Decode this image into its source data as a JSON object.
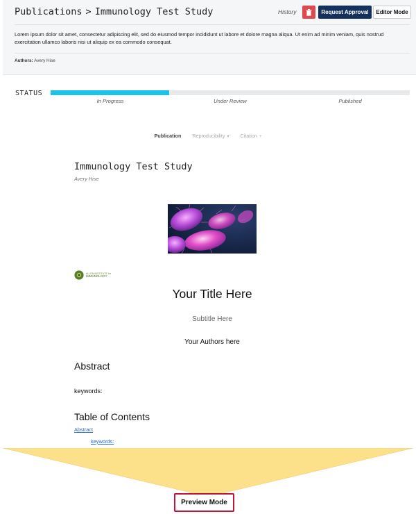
{
  "header": {
    "breadcrumb_root": "Publications",
    "breadcrumb_separator": ">",
    "breadcrumb_current": "Immunology Test Study",
    "history_label": "History",
    "delete_icon": "trash-icon",
    "request_approval_label": "Request Approval",
    "editor_mode_label": "Editor Mode",
    "description": "Lorem ipsum dolor sit amet, consectetur adipiscing elit, sed do eiusmod tempor incididunt ut labore et dolore magna aliqua. Ut enim ad minim veniam, quis nostrud exercitation ullamco laboris nisi ut aliquip ex ea commodo consequat.",
    "authors_label": "Authors:",
    "authors_value": "Avery Hise"
  },
  "status": {
    "label": "STATUS",
    "stages": [
      "In Progress",
      "Under Review",
      "Published"
    ],
    "current_stage_index": 0,
    "progress_fraction": 0.33,
    "fill_color": "#1ec2e6"
  },
  "tabs": [
    {
      "label": "Publication",
      "active": true,
      "caret": ""
    },
    {
      "label": "Reproducibility",
      "active": false,
      "caret": "▾"
    },
    {
      "label": "Citation",
      "active": false,
      "caret": "+"
    }
  ],
  "document": {
    "title": "Immunology Test Study",
    "author": "Avery Hise",
    "hero_image": "microbe-image",
    "logo_line1": "ALLEN INSTITUTE for",
    "logo_line2": "IMMUNOLOGY",
    "your_title": "Your Title Here",
    "subtitle": "Subtitle Here",
    "your_authors": "Your Authors here",
    "abstract_heading": "Abstract",
    "keywords_label": "keywords:",
    "toc_heading": "Table of Contents",
    "toc_links": [
      "Abstract",
      "keywords:"
    ]
  },
  "preview": {
    "label": "Preview Mode",
    "funnel_color": "#fde08a",
    "border_color": "#c0143c"
  },
  "colors": {
    "danger": "#e0484f",
    "primary": "#14305c",
    "link": "#2466d1"
  }
}
